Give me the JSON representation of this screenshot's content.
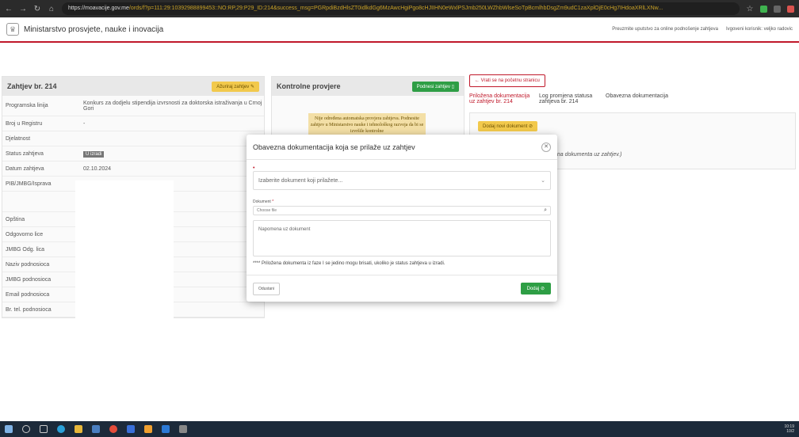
{
  "browser": {
    "url": "https://moavacije.gov.me/ords/f?p=111:29:10392988899453::NO:RP,29:P29_ID:214&success_msg=PGRpdiBzdHlsZ...",
    "url_host": "https://moavacije.gov.me",
    "url_rest": "/ords/f?p=111:29:10392988899453::NO:RP,29:P29_ID:214&success_msg=PGRpdiBzdHlsZT0idlkdGg6MzAwcHgiPgo8cHJIIHN0eWxlPSJmb250LWZhbWlseSoTpBcmlhbDsgZm9udC1zaXplOjE0cHg7IHdoaXRlLXNw..."
  },
  "header": {
    "title": "Ministarstvo prosvjete, nauke i inovacija",
    "guide_link": "Preuzmite uputstvo za online podnošenje zahtjeva",
    "user_label": "Ivgoveni korisnik: veljko radovic"
  },
  "left_panel": {
    "title": "Zahtjev br. 214",
    "edit_button": "Ažuriraj zahtjev",
    "rows": [
      {
        "label": "Programska linija",
        "value": "Konkurs za dodjelu stipendija izvrsnosti za doktorska istraživanja u Crnoj Gori"
      },
      {
        "label": "Broj u Registru",
        "value": "-"
      },
      {
        "label": "Djelatnost",
        "value": ""
      },
      {
        "label": "Status zahtjeva",
        "value": "U izradi"
      },
      {
        "label": "Datum zahtjeva",
        "value": "02.10.2024"
      },
      {
        "label": "PIB/JMBG/Isprava",
        "value": ""
      },
      {
        "label": "",
        "value": ""
      },
      {
        "label": "Opština",
        "value": ""
      },
      {
        "label": "Odgovorno lice",
        "value": ""
      },
      {
        "label": "JMBG Odg. lica",
        "value": ""
      },
      {
        "label": "Naziv podnosioca",
        "value": ""
      },
      {
        "label": "JMBG podnosioca",
        "value": ""
      },
      {
        "label": "Email podnosioca",
        "value": ""
      },
      {
        "label": "Br. tel. podnosioca",
        "value": ""
      }
    ]
  },
  "mid_panel": {
    "title": "Kontrolne provjere",
    "submit_button": "Podnesi zahtjev",
    "warning": "Nije određena automatska provjera zahtjeva. Podnesite zahtjev u Ministarstvo nauke i tehnološkog razvoja da bi se izvršile kontrolne"
  },
  "right_area": {
    "back_button": "Vrati se na početnu stranicu",
    "tabs": [
      "Priložena dokumentacija uz zahtjev br. 214",
      "Log promjena statusa zahtjeva br. 214",
      "Obavezna dokumentacija"
    ],
    "add_doc_button": "Dodaj novi dokument",
    "empty_text": "ena dokumenta uz zahtjev.)"
  },
  "modal": {
    "title": "Obavezna dokumentacija koja se prilaže uz zahtjev",
    "select_placeholder": "Izaberite dokument koji prilažete...",
    "document_label": "Dokument",
    "file_placeholder": "Choose file",
    "note_placeholder": "Napomena uz dokument",
    "note_text": "**** Priložena dokumenta iz faze I se jedino mogu brisati, ukoliko je status zahtjeva u izradi.",
    "cancel_button": "Odustani",
    "add_button": "Dodaj"
  },
  "taskbar": {
    "time": "10:19",
    "date": "10/2"
  },
  "colors": {
    "accent_red": "#c0182a",
    "green": "#2e9e45",
    "yellow": "#f2c94c"
  }
}
